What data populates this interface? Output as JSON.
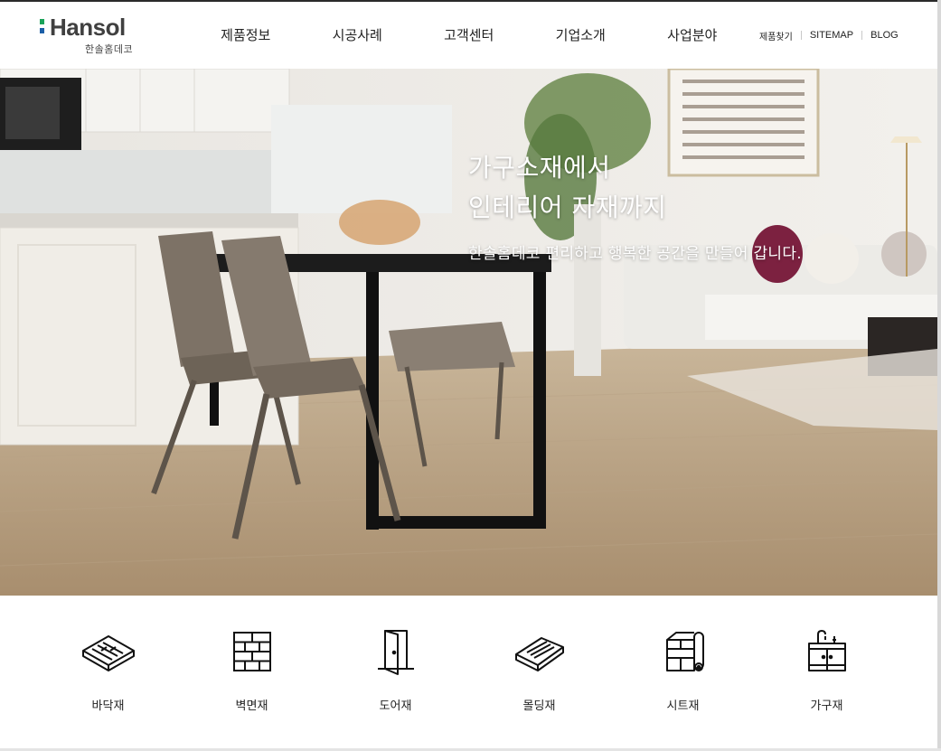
{
  "brand": {
    "name": "Hansol",
    "sub": "한솔홈데코",
    "mark_colors": {
      "top": "#1aa35a",
      "bottom": "#1b5fa8"
    }
  },
  "nav": {
    "items": [
      {
        "label": "제품정보"
      },
      {
        "label": "시공사례"
      },
      {
        "label": "고객센터"
      },
      {
        "label": "기업소개"
      },
      {
        "label": "사업분야"
      }
    ]
  },
  "util": {
    "find_product": "제품찾기",
    "sitemap": "SITEMAP",
    "blog": "BLOG"
  },
  "hero": {
    "title_line1": "가구소재에서",
    "title_line2": "인테리어 자재까지",
    "subtitle": "한솔홈데코 편리하고 행복한 공간을 만들어 갑니다."
  },
  "categories": [
    {
      "label": "바닥재",
      "icon": "floor-board-icon"
    },
    {
      "label": "벽면재",
      "icon": "brick-wall-icon"
    },
    {
      "label": "도어재",
      "icon": "door-icon"
    },
    {
      "label": "몰딩재",
      "icon": "molding-icon"
    },
    {
      "label": "시트재",
      "icon": "sheet-roll-icon"
    },
    {
      "label": "가구재",
      "icon": "kitchen-cabinet-icon"
    }
  ]
}
